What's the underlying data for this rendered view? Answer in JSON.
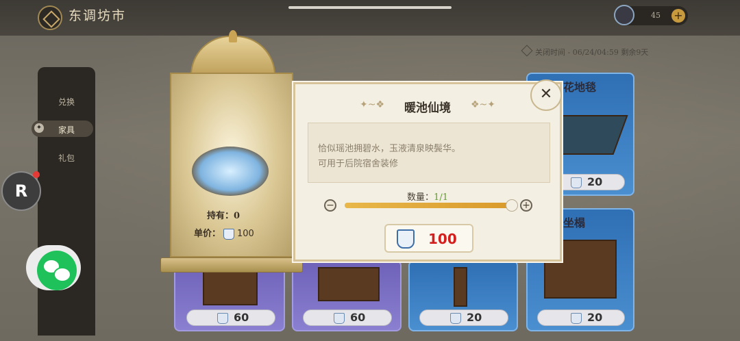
{
  "header": {
    "title": "东调坊市",
    "currency_amount": "45",
    "close_time": "关闭时间 - 06/24/04:59 剩余9天"
  },
  "sidebar": {
    "items": [
      {
        "label": "兑换"
      },
      {
        "label": "家具"
      },
      {
        "label": "礼包"
      }
    ],
    "selected": "家具"
  },
  "cards": [
    {
      "title": "印花地毯",
      "price": "20"
    },
    {
      "title": "",
      "price": "20"
    },
    {
      "title": "",
      "price": "60"
    },
    {
      "title": "",
      "price": "60"
    },
    {
      "title": "",
      "price": "20"
    },
    {
      "title": "木坐榻",
      "price": "20"
    }
  ],
  "preview": {
    "owned_label": "持有：0",
    "unit_price_label": "单价：",
    "unit_price_value": "100"
  },
  "detail": {
    "title": "暖池仙境",
    "desc_line1": "恰似瑶池拥碧水，玉液清泉映鬓华。",
    "desc_line2": "可用于后院宿舍装修",
    "qty_label": "数量：",
    "qty_value": "1/1",
    "qty_fraction": 1.0,
    "buy_price": "100"
  },
  "colors": {
    "price_red": "#d41f1f",
    "qty_green": "#5c9c2c",
    "slider_fill": "#e8b74a"
  },
  "icons": [
    "home-icon",
    "plus-icon",
    "close-icon",
    "minus-icon",
    "porcelain-cup-icon",
    "chat-icon"
  ]
}
